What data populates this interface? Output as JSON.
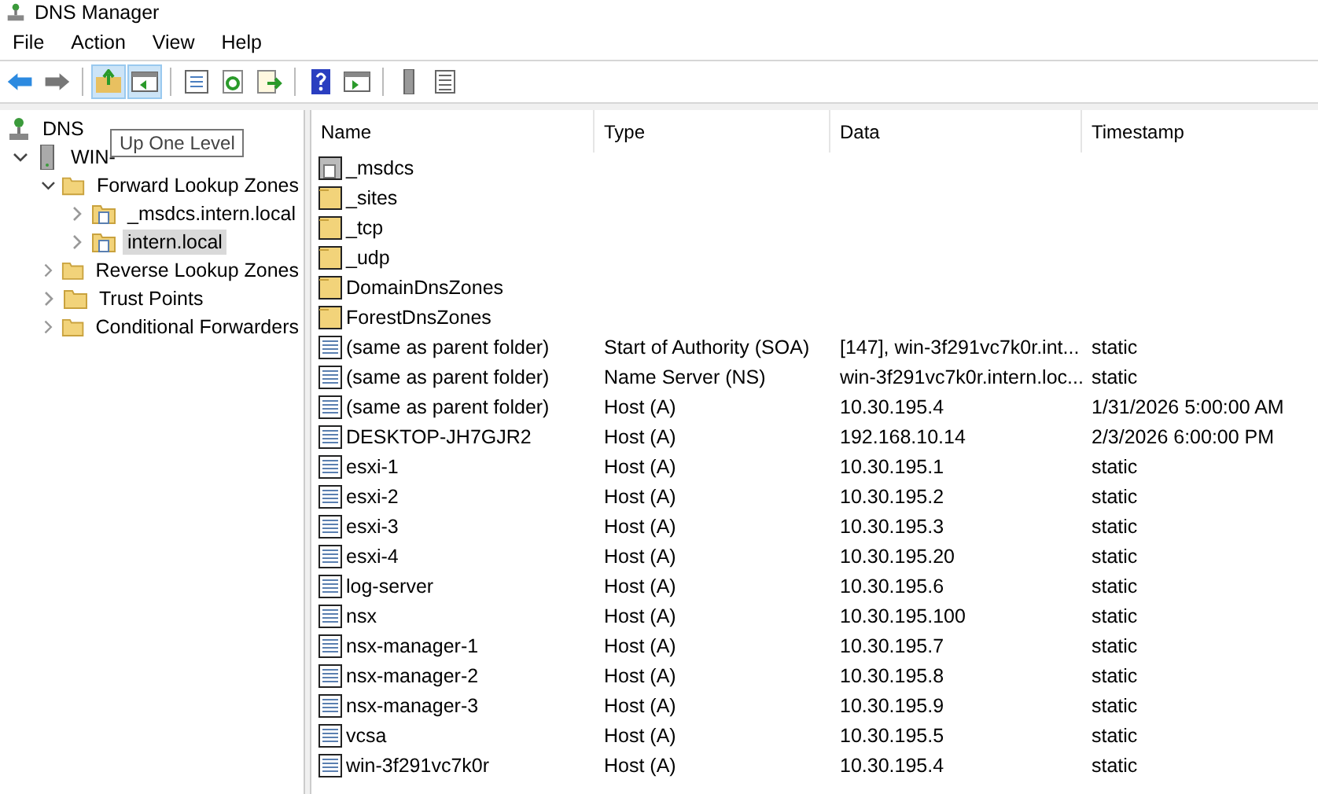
{
  "window": {
    "title": "DNS Manager"
  },
  "menu": [
    "File",
    "Action",
    "View",
    "Help"
  ],
  "toolbar": [
    {
      "kind": "back",
      "highlighted": false
    },
    {
      "kind": "forward",
      "highlighted": false
    },
    {
      "kind": "sep"
    },
    {
      "kind": "up",
      "highlighted": true
    },
    {
      "kind": "tree",
      "highlighted": true
    },
    {
      "kind": "sep"
    },
    {
      "kind": "properties",
      "highlighted": false
    },
    {
      "kind": "refresh",
      "highlighted": false
    },
    {
      "kind": "export",
      "highlighted": false
    },
    {
      "kind": "sep"
    },
    {
      "kind": "help",
      "highlighted": false
    },
    {
      "kind": "pane",
      "highlighted": false
    },
    {
      "kind": "sep"
    },
    {
      "kind": "server",
      "highlighted": false
    },
    {
      "kind": "list",
      "highlighted": false
    }
  ],
  "tooltip": "Up One Level",
  "tree": [
    {
      "label": "DNS",
      "kind": "dns",
      "selected": false,
      "children": [
        {
          "label": "WIN-",
          "kind": "server",
          "expanded": true,
          "selected": false,
          "children": [
            {
              "label": "Forward Lookup Zones",
              "kind": "folder",
              "expanded": true,
              "selected": false,
              "children": [
                {
                  "label": "_msdcs.intern.local",
                  "kind": "zone",
                  "expanded": false,
                  "selected": false
                },
                {
                  "label": "intern.local",
                  "kind": "zone",
                  "expanded": false,
                  "selected": true
                }
              ]
            },
            {
              "label": "Reverse Lookup Zones",
              "kind": "folder",
              "expanded": false,
              "selected": false
            },
            {
              "label": "Trust Points",
              "kind": "folder",
              "expanded": false,
              "selected": false
            },
            {
              "label": "Conditional Forwarders",
              "kind": "folder",
              "expanded": false,
              "selected": false
            }
          ]
        }
      ]
    }
  ],
  "table": {
    "columns": [
      "Name",
      "Type",
      "Data",
      "Timestamp"
    ],
    "rows": [
      {
        "kind": "zone",
        "name": "_msdcs"
      },
      {
        "kind": "folder",
        "name": "_sites"
      },
      {
        "kind": "folder",
        "name": "_tcp"
      },
      {
        "kind": "folder",
        "name": "_udp"
      },
      {
        "kind": "folder",
        "name": "DomainDnsZones"
      },
      {
        "kind": "folder",
        "name": "ForestDnsZones"
      },
      {
        "kind": "record",
        "name": "(same as parent folder)",
        "type": "Start of Authority (SOA)",
        "data": "[147], win-3f291vc7k0r.int...",
        "timestamp": "static"
      },
      {
        "kind": "record",
        "name": "(same as parent folder)",
        "type": "Name Server (NS)",
        "data": "win-3f291vc7k0r.intern.loc...",
        "timestamp": "static"
      },
      {
        "kind": "record",
        "name": "(same as parent folder)",
        "type": "Host (A)",
        "data": "10.30.195.4",
        "timestamp": "1/31/2026 5:00:00 AM"
      },
      {
        "kind": "record",
        "name": "DESKTOP-JH7GJR2",
        "type": "Host (A)",
        "data": "192.168.10.14",
        "timestamp": "2/3/2026 6:00:00 PM"
      },
      {
        "kind": "record",
        "name": "esxi-1",
        "type": "Host (A)",
        "data": "10.30.195.1",
        "timestamp": "static"
      },
      {
        "kind": "record",
        "name": "esxi-2",
        "type": "Host (A)",
        "data": "10.30.195.2",
        "timestamp": "static"
      },
      {
        "kind": "record",
        "name": "esxi-3",
        "type": "Host (A)",
        "data": "10.30.195.3",
        "timestamp": "static"
      },
      {
        "kind": "record",
        "name": "esxi-4",
        "type": "Host (A)",
        "data": "10.30.195.20",
        "timestamp": "static"
      },
      {
        "kind": "record",
        "name": "log-server",
        "type": "Host (A)",
        "data": "10.30.195.6",
        "timestamp": "static"
      },
      {
        "kind": "record",
        "name": "nsx",
        "type": "Host (A)",
        "data": "10.30.195.100",
        "timestamp": "static"
      },
      {
        "kind": "record",
        "name": "nsx-manager-1",
        "type": "Host (A)",
        "data": "10.30.195.7",
        "timestamp": "static"
      },
      {
        "kind": "record",
        "name": "nsx-manager-2",
        "type": "Host (A)",
        "data": "10.30.195.8",
        "timestamp": "static"
      },
      {
        "kind": "record",
        "name": "nsx-manager-3",
        "type": "Host (A)",
        "data": "10.30.195.9",
        "timestamp": "static"
      },
      {
        "kind": "record",
        "name": "vcsa",
        "type": "Host (A)",
        "data": "10.30.195.5",
        "timestamp": "static"
      },
      {
        "kind": "record",
        "name": "win-3f291vc7k0r",
        "type": "Host (A)",
        "data": "10.30.195.4",
        "timestamp": "static"
      }
    ]
  }
}
